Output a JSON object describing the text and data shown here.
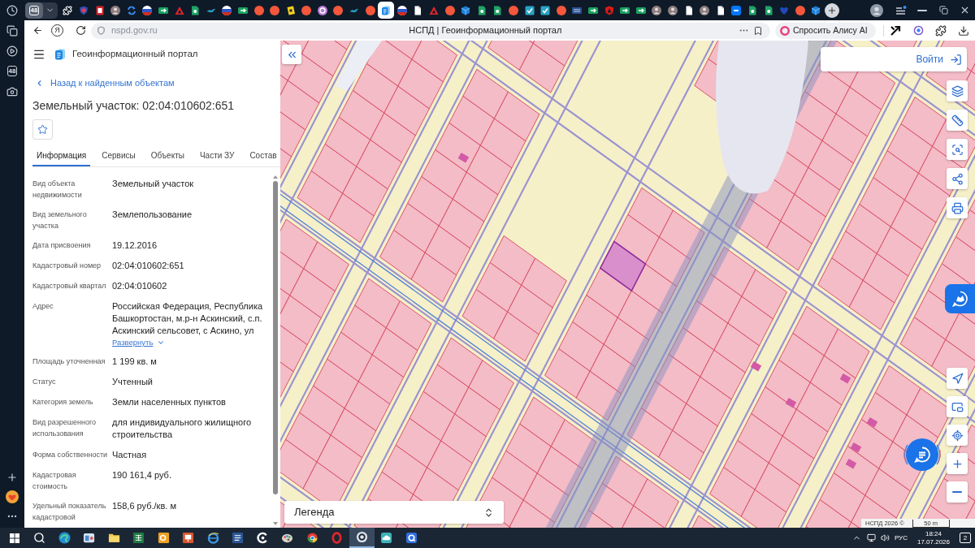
{
  "browser_sidebar": {
    "counter": "48"
  },
  "tab_strip": {
    "group_count": "48",
    "tabs": [
      {
        "kind": "puzzle",
        "selected": false
      },
      {
        "kind": "shield",
        "selected": false
      },
      {
        "kind": "doc-block",
        "selected": false
      },
      {
        "kind": "avatar",
        "selected": false
      },
      {
        "kind": "sync",
        "selected": false
      },
      {
        "kind": "flag",
        "selected": false
      },
      {
        "kind": "arrow-tile",
        "selected": false
      },
      {
        "kind": "triangle",
        "selected": false
      },
      {
        "kind": "doc-fold",
        "selected": false
      },
      {
        "kind": "bird",
        "selected": false
      },
      {
        "kind": "flag",
        "selected": false
      },
      {
        "kind": "arrow-tile",
        "selected": false
      },
      {
        "kind": "circle",
        "selected": false
      },
      {
        "kind": "circle",
        "selected": false
      },
      {
        "kind": "tilted-tile",
        "selected": false
      },
      {
        "kind": "circle",
        "selected": false
      },
      {
        "kind": "ring",
        "selected": false
      },
      {
        "kind": "circle",
        "selected": false
      },
      {
        "kind": "bird",
        "selected": false
      },
      {
        "kind": "circle",
        "selected": false
      },
      {
        "kind": "portal",
        "selected": true
      },
      {
        "kind": "flag",
        "selected": false
      },
      {
        "kind": "page",
        "selected": false
      },
      {
        "kind": "triangle",
        "selected": false
      },
      {
        "kind": "circle",
        "selected": false
      },
      {
        "kind": "cube",
        "selected": false
      },
      {
        "kind": "doc-fold",
        "selected": false
      },
      {
        "kind": "doc-fold",
        "selected": false
      },
      {
        "kind": "circle",
        "selected": false
      },
      {
        "kind": "check-tile",
        "selected": false
      },
      {
        "kind": "check-tile",
        "selected": false
      },
      {
        "kind": "circle",
        "selected": false
      },
      {
        "kind": "grid-tile",
        "selected": false
      },
      {
        "kind": "arrow-tile",
        "selected": false
      },
      {
        "kind": "shield-mark",
        "selected": false
      },
      {
        "kind": "arrow-tile",
        "selected": false
      },
      {
        "kind": "arrow-tile",
        "selected": false
      },
      {
        "kind": "avatar",
        "selected": false
      },
      {
        "kind": "avatar",
        "selected": false
      },
      {
        "kind": "page",
        "selected": false
      },
      {
        "kind": "avatar",
        "selected": false
      },
      {
        "kind": "page",
        "selected": false
      },
      {
        "kind": "square",
        "selected": false
      },
      {
        "kind": "doc-fold",
        "selected": false
      },
      {
        "kind": "doc-fold",
        "selected": false
      },
      {
        "kind": "heart",
        "selected": false
      },
      {
        "kind": "circle",
        "selected": false
      },
      {
        "kind": "cube",
        "selected": false
      }
    ]
  },
  "address_bar": {
    "logo": "Я",
    "url": "nspd.gov.ru",
    "page_title": "НСПД | Геоинформационный портал",
    "alice_button": "Спросить Алису AI"
  },
  "portal": {
    "title": "Геоинформационный портал",
    "back_link": "Назад к найденным объектам",
    "object_title": "Земельный участок: 02:04:010602:651",
    "tabs": [
      {
        "label": "Информация",
        "selected": true
      },
      {
        "label": "Сервисы",
        "selected": false
      },
      {
        "label": "Объекты",
        "selected": false
      },
      {
        "label": "Части ЗУ",
        "selected": false
      },
      {
        "label": "Состав",
        "selected": false
      }
    ],
    "fields": [
      {
        "label": "Вид объекта недвижимости",
        "value": "Земельный участок"
      },
      {
        "label": "Вид земельного участка",
        "value": "Землепользование"
      },
      {
        "label": "Дата присвоения",
        "value": "19.12.2016"
      },
      {
        "label": "Кадастровый номер",
        "value": "02:04:010602:651"
      },
      {
        "label": "Кадастровый квартал",
        "value": "02:04:010602"
      },
      {
        "label": "Адрес",
        "value": "Российская Федерация, Республика Башкортостан, м.р-н Аскинский, с.п. Аскинский сельсовет, с Аскино, ул",
        "expand_link": "Развернуть"
      },
      {
        "label": "Площадь уточненная",
        "value": "1 199 кв. м"
      },
      {
        "label": "Статус",
        "value": "Учтенный"
      },
      {
        "label": "Категория земель",
        "value": "Земли населенных пунктов"
      },
      {
        "label": "Вид разрешенного использования",
        "value": "для индивидуального жилищного строительства"
      },
      {
        "label": "Форма собственности",
        "value": "Частная"
      },
      {
        "label": "Кадастровая стоимость",
        "value": "190 161,4 руб."
      },
      {
        "label": "Удельный показатель кадастровой",
        "value": "158,6 руб./кв. м"
      }
    ]
  },
  "map": {
    "login_button": "Войти",
    "legend": "Легенда",
    "attribution": "НСПД 2026 ©",
    "scale": "50 m"
  },
  "taskbar": {
    "apps": [
      {
        "kind": "swirl",
        "selected": false
      },
      {
        "kind": "app-window",
        "selected": false
      },
      {
        "kind": "folder",
        "selected": false
      },
      {
        "kind": "sheet",
        "selected": false
      },
      {
        "kind": "mail",
        "selected": false
      },
      {
        "kind": "slides",
        "selected": false
      },
      {
        "kind": "globe",
        "selected": false
      },
      {
        "kind": "doc",
        "selected": false
      },
      {
        "kind": "c-ring",
        "selected": false
      },
      {
        "kind": "palette",
        "selected": false
      },
      {
        "kind": "wheel",
        "selected": false
      },
      {
        "kind": "ring",
        "selected": false
      },
      {
        "kind": "browser",
        "selected": true
      },
      {
        "kind": "cloud",
        "selected": false
      },
      {
        "kind": "q-ring",
        "selected": false
      }
    ],
    "language": "РУС",
    "time": "18:24",
    "date": "17.07.2026",
    "notifications": "2"
  }
}
